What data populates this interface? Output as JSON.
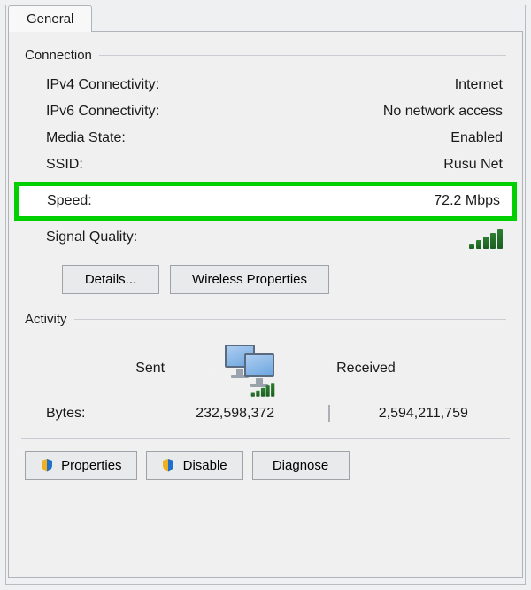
{
  "tab": {
    "label": "General"
  },
  "connection": {
    "group_label": "Connection",
    "rows": [
      {
        "label": "IPv4 Connectivity:",
        "value": "Internet"
      },
      {
        "label": "IPv6 Connectivity:",
        "value": "No network access"
      },
      {
        "label": "Media State:",
        "value": "Enabled"
      },
      {
        "label": "SSID:",
        "value": "Rusu Net"
      }
    ],
    "speed": {
      "label": "Speed:",
      "value": "72.2 Mbps"
    },
    "signal_quality_label": "Signal Quality:",
    "buttons": {
      "details": "Details...",
      "wireless": "Wireless Properties"
    }
  },
  "activity": {
    "group_label": "Activity",
    "sent_label": "Sent",
    "received_label": "Received",
    "bytes_label": "Bytes:",
    "bytes_sent": "232,598,372",
    "bytes_received": "2,594,211,759"
  },
  "footer": {
    "properties": "Properties",
    "disable": "Disable",
    "diagnose": "Diagnose"
  }
}
